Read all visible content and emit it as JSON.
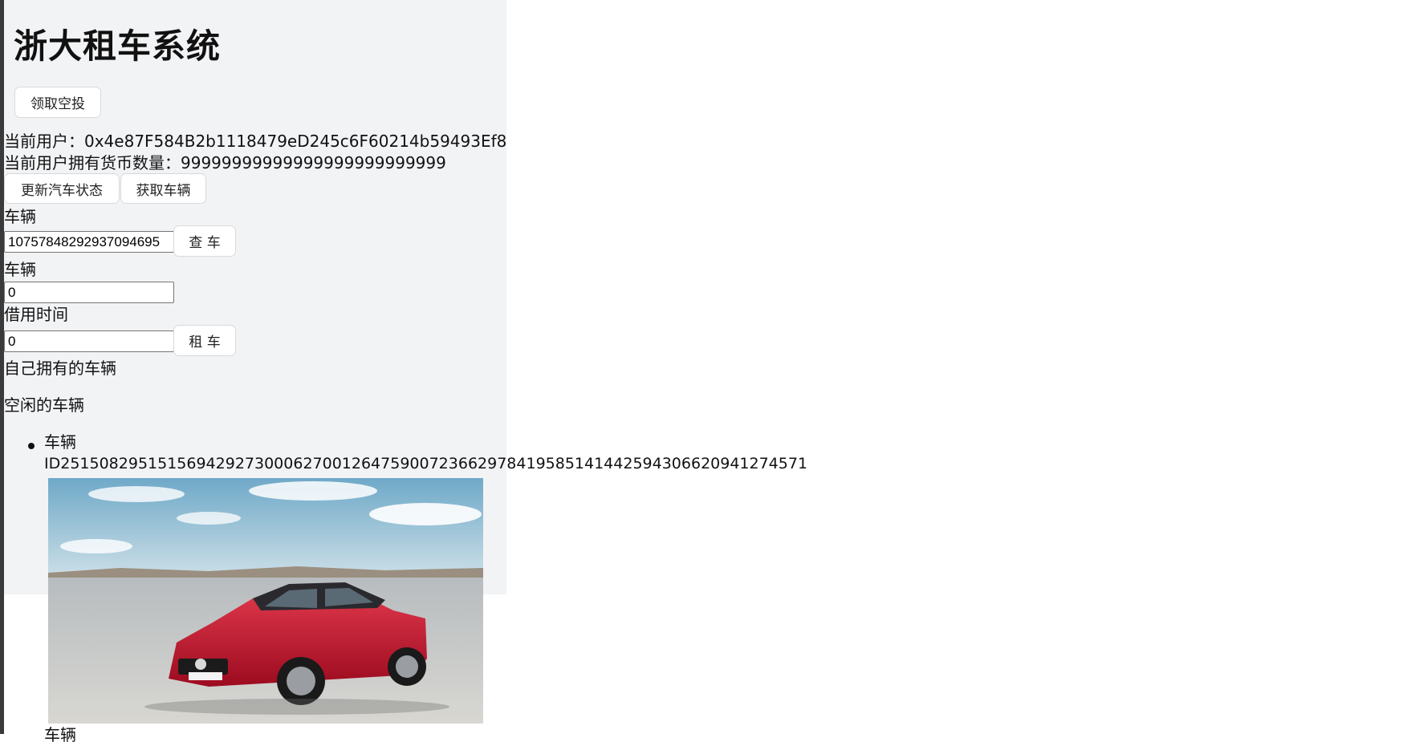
{
  "app": {
    "title": "浙大租车系统"
  },
  "airdrop": {
    "button_label": "领取空投"
  },
  "user": {
    "current_label": "当前用户：",
    "address": "0x4e87F584B2b1118479eD245c6F60214b59493Ef8",
    "balance_label": "当前用户拥有货币数量：",
    "balance": "99999999999999999999999999"
  },
  "actions": {
    "update_status_label": "更新汽车状态",
    "get_cars_label": "获取车辆"
  },
  "query": {
    "label": "车辆",
    "input_value": "10757848292937094695",
    "button_label": "查 车"
  },
  "rent": {
    "car_label": "车辆",
    "car_value": "0",
    "time_label": "借用时间",
    "time_value": "0",
    "button_label": "租 车"
  },
  "sections": {
    "owned_label": "自己拥有的车辆",
    "idle_label": "空闲的车辆"
  },
  "idle_cars": [
    {
      "label": "车辆",
      "id": "ID25150829515156942927300062700126475900723662978419585141442594306620941274571",
      "image": "red-sedan-photo"
    },
    {
      "label": "车辆"
    }
  ],
  "colors": {
    "panel_bg": "#f2f3f5",
    "car_red": "#c8102e",
    "sky": "#8fc0d8"
  }
}
